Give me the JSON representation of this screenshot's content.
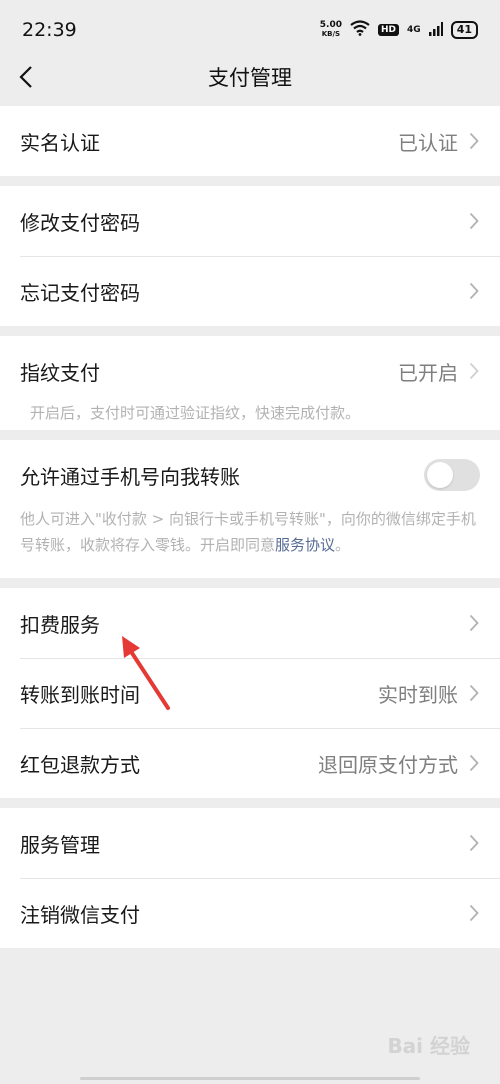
{
  "status": {
    "time": "22:39",
    "speed_value": "5.00",
    "speed_unit": "KB/S",
    "hd": "HD",
    "network": "4G",
    "battery": "41"
  },
  "nav": {
    "title": "支付管理"
  },
  "rows": {
    "realname": {
      "label": "实名认证",
      "value": "已认证"
    },
    "change_pwd": {
      "label": "修改支付密码"
    },
    "forgot_pwd": {
      "label": "忘记支付密码"
    },
    "fingerprint": {
      "label": "指纹支付",
      "value": "已开启",
      "desc": "开启后，支付时可通过验证指纹，快速完成付款。"
    },
    "phone_transfer": {
      "label": "允许通过手机号向我转账",
      "desc_1": "他人可进入\"收付款 > 向银行卡或手机号转账\"，向你的微信绑定手机号转账，收款将存入零钱。开启即同意",
      "desc_link": "服务协议",
      "desc_end": "。",
      "enabled": false
    },
    "deduction": {
      "label": "扣费服务"
    },
    "transfer_time": {
      "label": "转账到账时间",
      "value": "实时到账"
    },
    "redpacket_refund": {
      "label": "红包退款方式",
      "value": "退回原支付方式"
    },
    "service_mgmt": {
      "label": "服务管理"
    },
    "cancel_pay": {
      "label": "注销微信支付"
    }
  },
  "watermark": "Bai 经验",
  "colors": {
    "background": "#ededed",
    "link": "#576b95",
    "annotation_arrow": "#e53935"
  }
}
